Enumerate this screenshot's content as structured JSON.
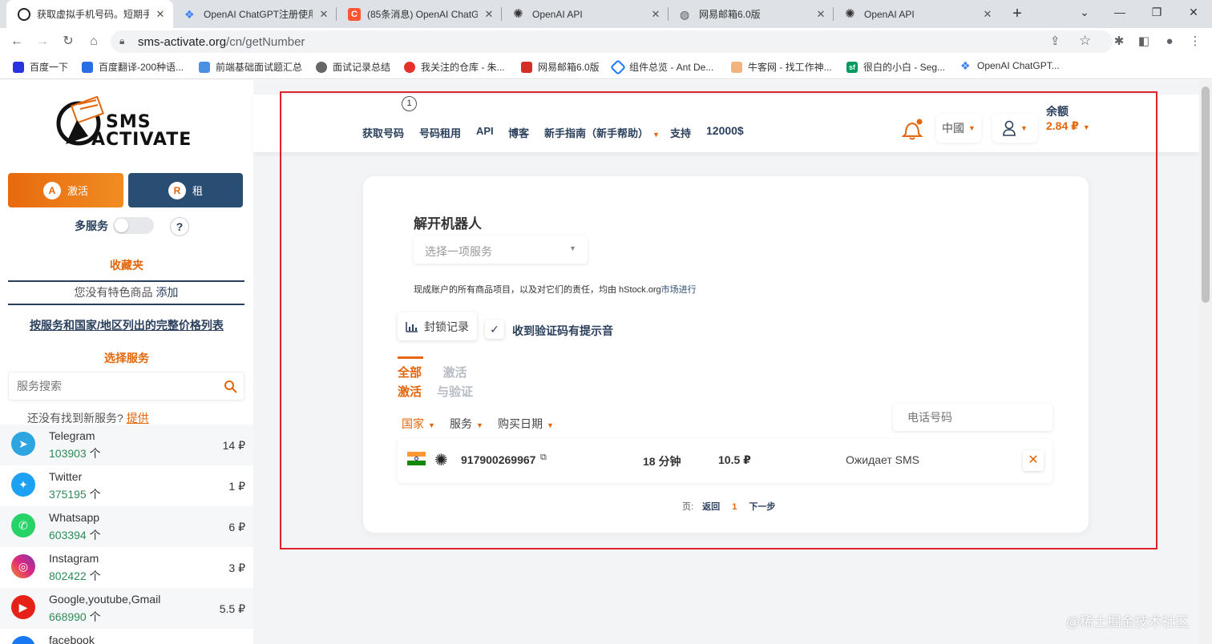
{
  "browser": {
    "tabs": [
      {
        "title": "获取虚拟手机号码。短期手",
        "active": true
      },
      {
        "title": "OpenAI ChatGPT注册使用",
        "active": false
      },
      {
        "title": "(85条消息) OpenAI ChatG",
        "active": false
      },
      {
        "title": "OpenAI API",
        "active": false
      },
      {
        "title": "网易邮箱6.0版",
        "active": false
      },
      {
        "title": "OpenAI API",
        "active": false
      }
    ],
    "new_tab": "+",
    "url_host": "sms-activate.org",
    "url_path": "/cn/getNumber",
    "bookmarks": [
      "百度一下",
      "百度翻译-200种语...",
      "前端基础面试题汇总",
      "面试记录总结",
      "我关注的仓库 - 朱...",
      "网易邮箱6.0版",
      "组件总览 - Ant De...",
      "牛客网 - 找工作神...",
      "很白的小白 - Seg...",
      "OpenAI ChatGPT..."
    ]
  },
  "sidebar": {
    "logo_line1": "SMS",
    "logo_line2": "ACTIVATE",
    "activate_label": "激活",
    "rent_label": "租",
    "multi_service_label": "多服务",
    "help_label": "?",
    "favorites_title": "收藏夹",
    "no_favorites_text": "您没有特色商品",
    "add_link": "添加",
    "price_list_link": "按服务和国家/地区列出的完整价格列表",
    "select_service_title": "选择服务",
    "search_placeholder": "服务搜索",
    "not_found_text": "还没有找到新服务?",
    "provide_link": "提供",
    "unit": "个",
    "services": [
      {
        "name": "Telegram",
        "count": "103903",
        "price": "14 ₽",
        "color": "#2ca5e0",
        "icon": "telegram-icon"
      },
      {
        "name": "Twitter",
        "count": "375195",
        "price": "1 ₽",
        "color": "#1da1f2",
        "icon": "twitter-icon"
      },
      {
        "name": "Whatsapp",
        "count": "603394",
        "price": "6 ₽",
        "color": "#25d366",
        "icon": "whatsapp-icon"
      },
      {
        "name": "Instagram",
        "count": "802422",
        "price": "3 ₽",
        "color": "#d6249f",
        "icon": "instagram-icon"
      },
      {
        "name": "Google,youtube,Gmail",
        "count": "668990",
        "price": "5.5 ₽",
        "color": "#e62117",
        "icon": "youtube-icon"
      },
      {
        "name": "facebook",
        "count": "",
        "price": "",
        "color": "#1877f2",
        "icon": "facebook-icon"
      }
    ]
  },
  "header": {
    "nav": [
      "获取号码",
      "号码租用",
      "API",
      "博客",
      "新手指南（新手帮助）",
      "支持",
      "12000$"
    ],
    "badge": "1",
    "country": "中國",
    "balance_label": "余额",
    "balance_value": "2.84 ₽"
  },
  "card": {
    "title": "解开机器人",
    "select_placeholder": "选择一项服务",
    "notice_text": "现成账户的所有商品项目，以及对它们的责任，均由 hStock.org",
    "notice_link": "市场进行",
    "ban_history": "封锁记录",
    "sound_label": "收到验证码有提示音",
    "tab_all_line1": "全部",
    "tab_all_line2": "激活",
    "tab_verify_line1": "激活",
    "tab_verify_line2": "与验证",
    "filter_country": "国家",
    "filter_service": "服务",
    "filter_date": "购买日期",
    "phone_placeholder": "电话号码",
    "row": {
      "number": "917900269967",
      "time": "18 分钟",
      "price": "10.5 ₽",
      "status": "Ожидает SMS"
    },
    "pagination_label": "页:",
    "back_link": "返回",
    "current_page": "1",
    "next_link": "下一步"
  },
  "watermark": "@稀土掘金技术社区",
  "colors": {
    "accent": "#e3660a",
    "navy": "#2a3f5c",
    "highlight_box": "#e0222a"
  }
}
